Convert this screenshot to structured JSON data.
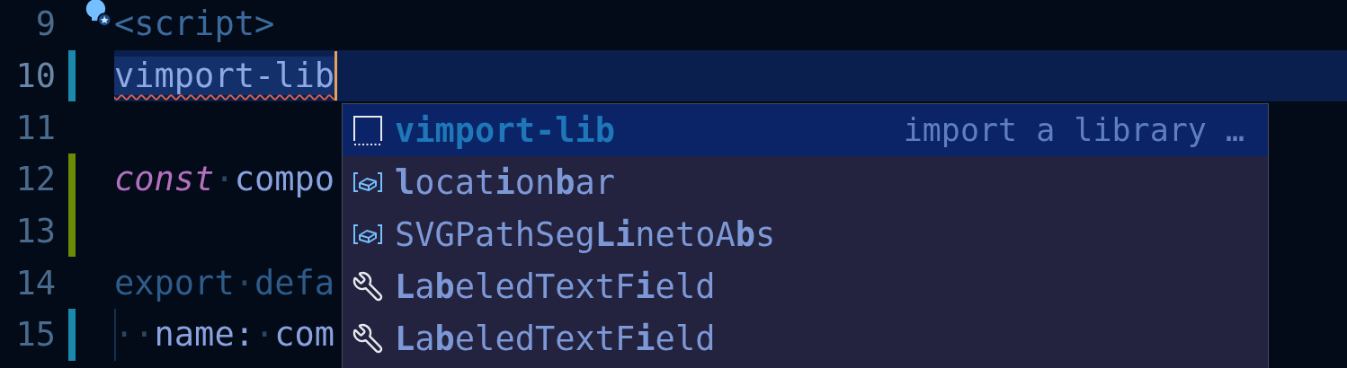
{
  "editor": {
    "lines": [
      {
        "number": "9",
        "current": false,
        "lightbulb": true,
        "tokens": [
          {
            "kind": "tag",
            "text": "<script>"
          }
        ]
      },
      {
        "number": "10",
        "color": "#1b88ad",
        "current": true,
        "tokens": [
          {
            "kind": "error",
            "text": "vimport-lib"
          }
        ]
      },
      {
        "number": "11",
        "current": false
      },
      {
        "number": "12",
        "color": "#6d8a07",
        "current": false,
        "tokens": [
          {
            "kind": "keyword",
            "text": "const"
          },
          {
            "kind": "whitespace",
            "text": "·"
          },
          {
            "kind": "plain",
            "text": "compo"
          }
        ]
      },
      {
        "number": "13",
        "color": "#6d8a07",
        "current": false
      },
      {
        "number": "14",
        "current": false,
        "tokens": [
          {
            "kind": "dim",
            "text": "export"
          },
          {
            "kind": "whitespace",
            "text": "·"
          },
          {
            "kind": "dim",
            "text": "defa"
          }
        ]
      },
      {
        "number": "15",
        "color": "#1b88ad",
        "current": false,
        "indent_guide": true,
        "tokens": [
          {
            "kind": "whitespace",
            "text": "··"
          },
          {
            "kind": "plain",
            "text": "name:"
          },
          {
            "kind": "whitespace",
            "text": "·"
          },
          {
            "kind": "plain",
            "text": "com"
          }
        ]
      }
    ]
  },
  "suggestions": [
    {
      "kind": "snippet",
      "label": "vimport-lib",
      "detail": "import a library …",
      "selected": true
    },
    {
      "kind": "variable",
      "label": "**l**ocat**i**on**b**ar",
      "selected": false
    },
    {
      "kind": "variable",
      "label": "SVGPathSeg**Li**netoA**b**s",
      "selected": false
    },
    {
      "kind": "property",
      "label": "**L**a**b**eledTextF**i**eld",
      "selected": false
    },
    {
      "kind": "property",
      "label": "**L**a**b**eledTextF**i**eld",
      "selected": false
    }
  ]
}
